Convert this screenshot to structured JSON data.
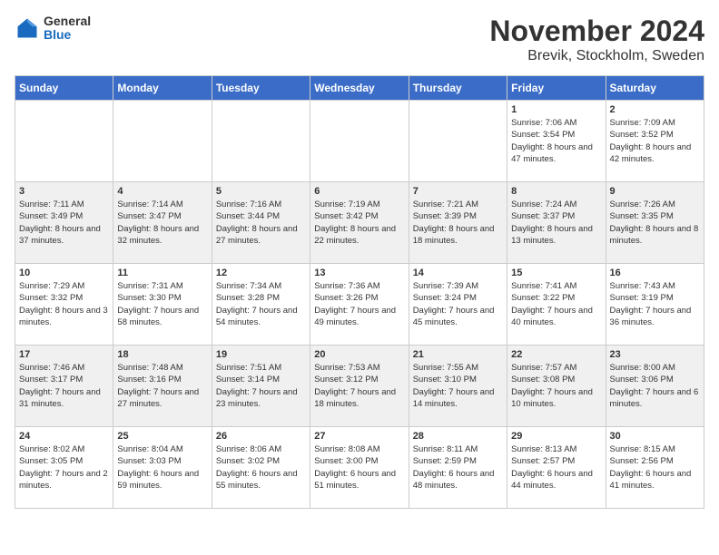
{
  "logo": {
    "general": "General",
    "blue": "Blue"
  },
  "title": "November 2024",
  "subtitle": "Brevik, Stockholm, Sweden",
  "days_of_week": [
    "Sunday",
    "Monday",
    "Tuesday",
    "Wednesday",
    "Thursday",
    "Friday",
    "Saturday"
  ],
  "weeks": [
    [
      {
        "day": "",
        "info": ""
      },
      {
        "day": "",
        "info": ""
      },
      {
        "day": "",
        "info": ""
      },
      {
        "day": "",
        "info": ""
      },
      {
        "day": "",
        "info": ""
      },
      {
        "day": "1",
        "info": "Sunrise: 7:06 AM\nSunset: 3:54 PM\nDaylight: 8 hours and 47 minutes."
      },
      {
        "day": "2",
        "info": "Sunrise: 7:09 AM\nSunset: 3:52 PM\nDaylight: 8 hours and 42 minutes."
      }
    ],
    [
      {
        "day": "3",
        "info": "Sunrise: 7:11 AM\nSunset: 3:49 PM\nDaylight: 8 hours and 37 minutes."
      },
      {
        "day": "4",
        "info": "Sunrise: 7:14 AM\nSunset: 3:47 PM\nDaylight: 8 hours and 32 minutes."
      },
      {
        "day": "5",
        "info": "Sunrise: 7:16 AM\nSunset: 3:44 PM\nDaylight: 8 hours and 27 minutes."
      },
      {
        "day": "6",
        "info": "Sunrise: 7:19 AM\nSunset: 3:42 PM\nDaylight: 8 hours and 22 minutes."
      },
      {
        "day": "7",
        "info": "Sunrise: 7:21 AM\nSunset: 3:39 PM\nDaylight: 8 hours and 18 minutes."
      },
      {
        "day": "8",
        "info": "Sunrise: 7:24 AM\nSunset: 3:37 PM\nDaylight: 8 hours and 13 minutes."
      },
      {
        "day": "9",
        "info": "Sunrise: 7:26 AM\nSunset: 3:35 PM\nDaylight: 8 hours and 8 minutes."
      }
    ],
    [
      {
        "day": "10",
        "info": "Sunrise: 7:29 AM\nSunset: 3:32 PM\nDaylight: 8 hours and 3 minutes."
      },
      {
        "day": "11",
        "info": "Sunrise: 7:31 AM\nSunset: 3:30 PM\nDaylight: 7 hours and 58 minutes."
      },
      {
        "day": "12",
        "info": "Sunrise: 7:34 AM\nSunset: 3:28 PM\nDaylight: 7 hours and 54 minutes."
      },
      {
        "day": "13",
        "info": "Sunrise: 7:36 AM\nSunset: 3:26 PM\nDaylight: 7 hours and 49 minutes."
      },
      {
        "day": "14",
        "info": "Sunrise: 7:39 AM\nSunset: 3:24 PM\nDaylight: 7 hours and 45 minutes."
      },
      {
        "day": "15",
        "info": "Sunrise: 7:41 AM\nSunset: 3:22 PM\nDaylight: 7 hours and 40 minutes."
      },
      {
        "day": "16",
        "info": "Sunrise: 7:43 AM\nSunset: 3:19 PM\nDaylight: 7 hours and 36 minutes."
      }
    ],
    [
      {
        "day": "17",
        "info": "Sunrise: 7:46 AM\nSunset: 3:17 PM\nDaylight: 7 hours and 31 minutes."
      },
      {
        "day": "18",
        "info": "Sunrise: 7:48 AM\nSunset: 3:16 PM\nDaylight: 7 hours and 27 minutes."
      },
      {
        "day": "19",
        "info": "Sunrise: 7:51 AM\nSunset: 3:14 PM\nDaylight: 7 hours and 23 minutes."
      },
      {
        "day": "20",
        "info": "Sunrise: 7:53 AM\nSunset: 3:12 PM\nDaylight: 7 hours and 18 minutes."
      },
      {
        "day": "21",
        "info": "Sunrise: 7:55 AM\nSunset: 3:10 PM\nDaylight: 7 hours and 14 minutes."
      },
      {
        "day": "22",
        "info": "Sunrise: 7:57 AM\nSunset: 3:08 PM\nDaylight: 7 hours and 10 minutes."
      },
      {
        "day": "23",
        "info": "Sunrise: 8:00 AM\nSunset: 3:06 PM\nDaylight: 7 hours and 6 minutes."
      }
    ],
    [
      {
        "day": "24",
        "info": "Sunrise: 8:02 AM\nSunset: 3:05 PM\nDaylight: 7 hours and 2 minutes."
      },
      {
        "day": "25",
        "info": "Sunrise: 8:04 AM\nSunset: 3:03 PM\nDaylight: 6 hours and 59 minutes."
      },
      {
        "day": "26",
        "info": "Sunrise: 8:06 AM\nSunset: 3:02 PM\nDaylight: 6 hours and 55 minutes."
      },
      {
        "day": "27",
        "info": "Sunrise: 8:08 AM\nSunset: 3:00 PM\nDaylight: 6 hours and 51 minutes."
      },
      {
        "day": "28",
        "info": "Sunrise: 8:11 AM\nSunset: 2:59 PM\nDaylight: 6 hours and 48 minutes."
      },
      {
        "day": "29",
        "info": "Sunrise: 8:13 AM\nSunset: 2:57 PM\nDaylight: 6 hours and 44 minutes."
      },
      {
        "day": "30",
        "info": "Sunrise: 8:15 AM\nSunset: 2:56 PM\nDaylight: 6 hours and 41 minutes."
      }
    ]
  ]
}
